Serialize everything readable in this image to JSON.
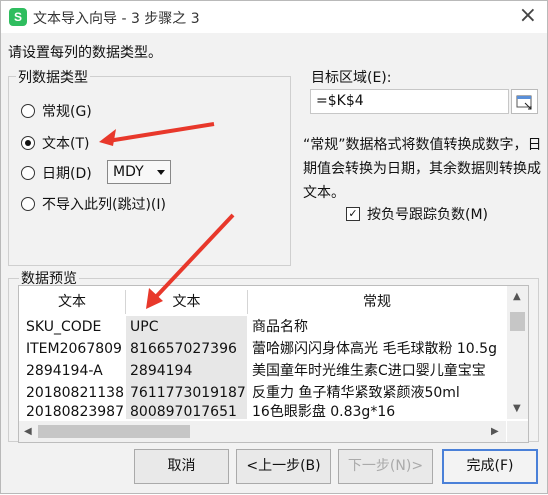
{
  "title": "文本导入向导 - 3 步骤之 3",
  "prompt": "请设置每列的数据类型。",
  "column_type": {
    "heading": "列数据类型",
    "options": [
      "常规(G)",
      "文本(T)",
      "日期(D)",
      "不导入此列(跳过)(I)"
    ],
    "selected": "文本(T)",
    "date_format": "MDY"
  },
  "destination": {
    "label": "目标区域(E):",
    "value": "=$K$4"
  },
  "description": "“常规”数据格式将数值转换成数字，日期值会转换为日期，其余数据则转换成文本。",
  "negative_checkbox": {
    "label": "按负号跟踪负数(M)",
    "checked": true
  },
  "preview": {
    "heading": "数据预览",
    "headers": [
      "文本",
      "文本",
      "常规"
    ],
    "rows": [
      [
        "SKU_CODE",
        "UPC",
        "商品名称"
      ],
      [
        "ITEM2067809",
        "816657027396",
        "蕾哈娜闪闪身体高光 毛毛球散粉 10.5g"
      ],
      [
        "2894194-A",
        "2894194",
        "美国童年时光维生素C进口婴儿童宝宝"
      ],
      [
        "20180821138",
        "7611773019187",
        "反重力 鱼子精华紧致紧颜液50ml"
      ],
      [
        "20180823987",
        "800897017651",
        "16色眼影盘 0.83g*16"
      ]
    ]
  },
  "buttons": {
    "cancel": "取消",
    "back": "<上一步(B)",
    "next": "下一步(N)>",
    "finish": "完成(F)"
  },
  "colors": {
    "annotation": "#e8382b",
    "focus": "#4a80d8",
    "app": "#2fbd5f"
  }
}
